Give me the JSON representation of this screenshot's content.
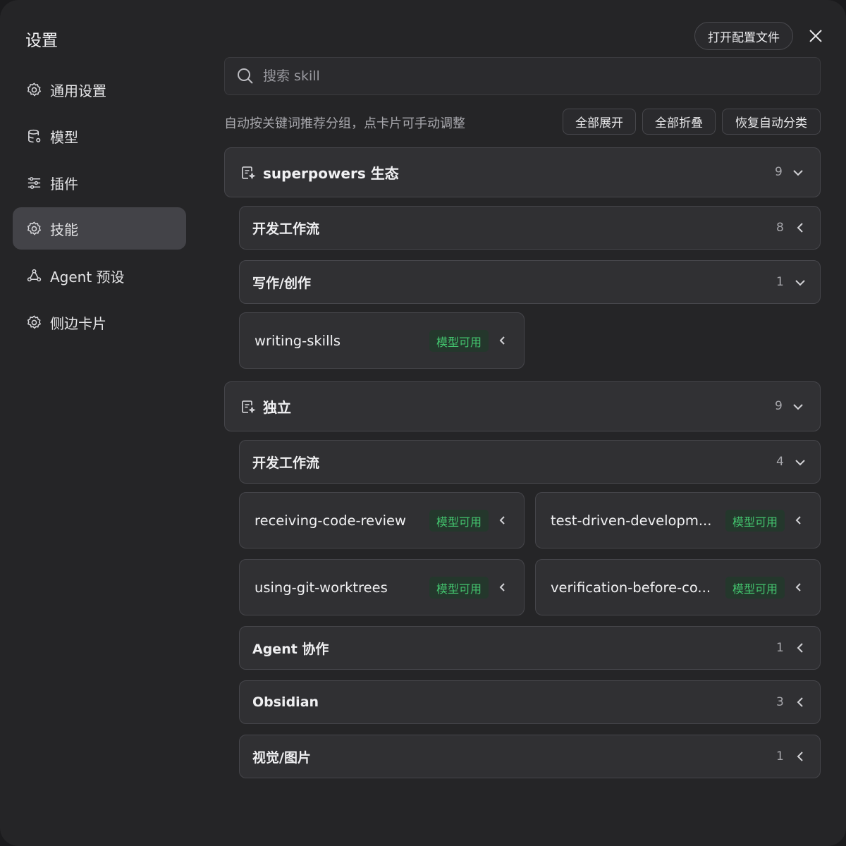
{
  "sidebar": {
    "title": "设置",
    "items": [
      {
        "label": "通用设置",
        "icon": "gear-icon"
      },
      {
        "label": "模型",
        "icon": "database-icon"
      },
      {
        "label": "插件",
        "icon": "sliders-icon"
      },
      {
        "label": "技能",
        "icon": "gear-icon",
        "active": true
      },
      {
        "label": "Agent 预设",
        "icon": "network-icon"
      },
      {
        "label": "侧边卡片",
        "icon": "gear-icon"
      }
    ]
  },
  "header": {
    "open_config_label": "打开配置文件",
    "close_icon": "close-icon"
  },
  "search": {
    "placeholder": "搜索 skill",
    "value": ""
  },
  "toolbar": {
    "hint": "自动按关键词推荐分组，点卡片可手动调整",
    "expand_all": "全部展开",
    "collapse_all": "全部折叠",
    "restore_auto": "恢复自动分类"
  },
  "groups": [
    {
      "title": "superpowers 生态",
      "count": "9",
      "expanded": true,
      "subgroups": [
        {
          "title": "开发工作流",
          "count": "8",
          "expanded": false,
          "cards": []
        },
        {
          "title": "写作/创作",
          "count": "1",
          "expanded": true,
          "cards": [
            {
              "name": "writing-skills",
              "badge": "模型可用"
            }
          ]
        }
      ]
    },
    {
      "title": "独立",
      "count": "9",
      "expanded": true,
      "subgroups": [
        {
          "title": "开发工作流",
          "count": "4",
          "expanded": true,
          "cards": [
            {
              "name": "receiving-code-review",
              "badge": "模型可用"
            },
            {
              "name": "test-driven-developm...",
              "badge": "模型可用"
            },
            {
              "name": "using-git-worktrees",
              "badge": "模型可用"
            },
            {
              "name": "verification-before-co...",
              "badge": "模型可用"
            }
          ]
        },
        {
          "title": "Agent 协作",
          "count": "1",
          "expanded": false,
          "cards": []
        },
        {
          "title": "Obsidian",
          "count": "3",
          "expanded": false,
          "cards": []
        },
        {
          "title": "视觉/图片",
          "count": "1",
          "expanded": false,
          "cards": []
        }
      ]
    }
  ],
  "colors": {
    "background": "#252527",
    "active_nav": "#434348",
    "badge_text": "#43c46e",
    "badge_bg": "#24372c"
  }
}
